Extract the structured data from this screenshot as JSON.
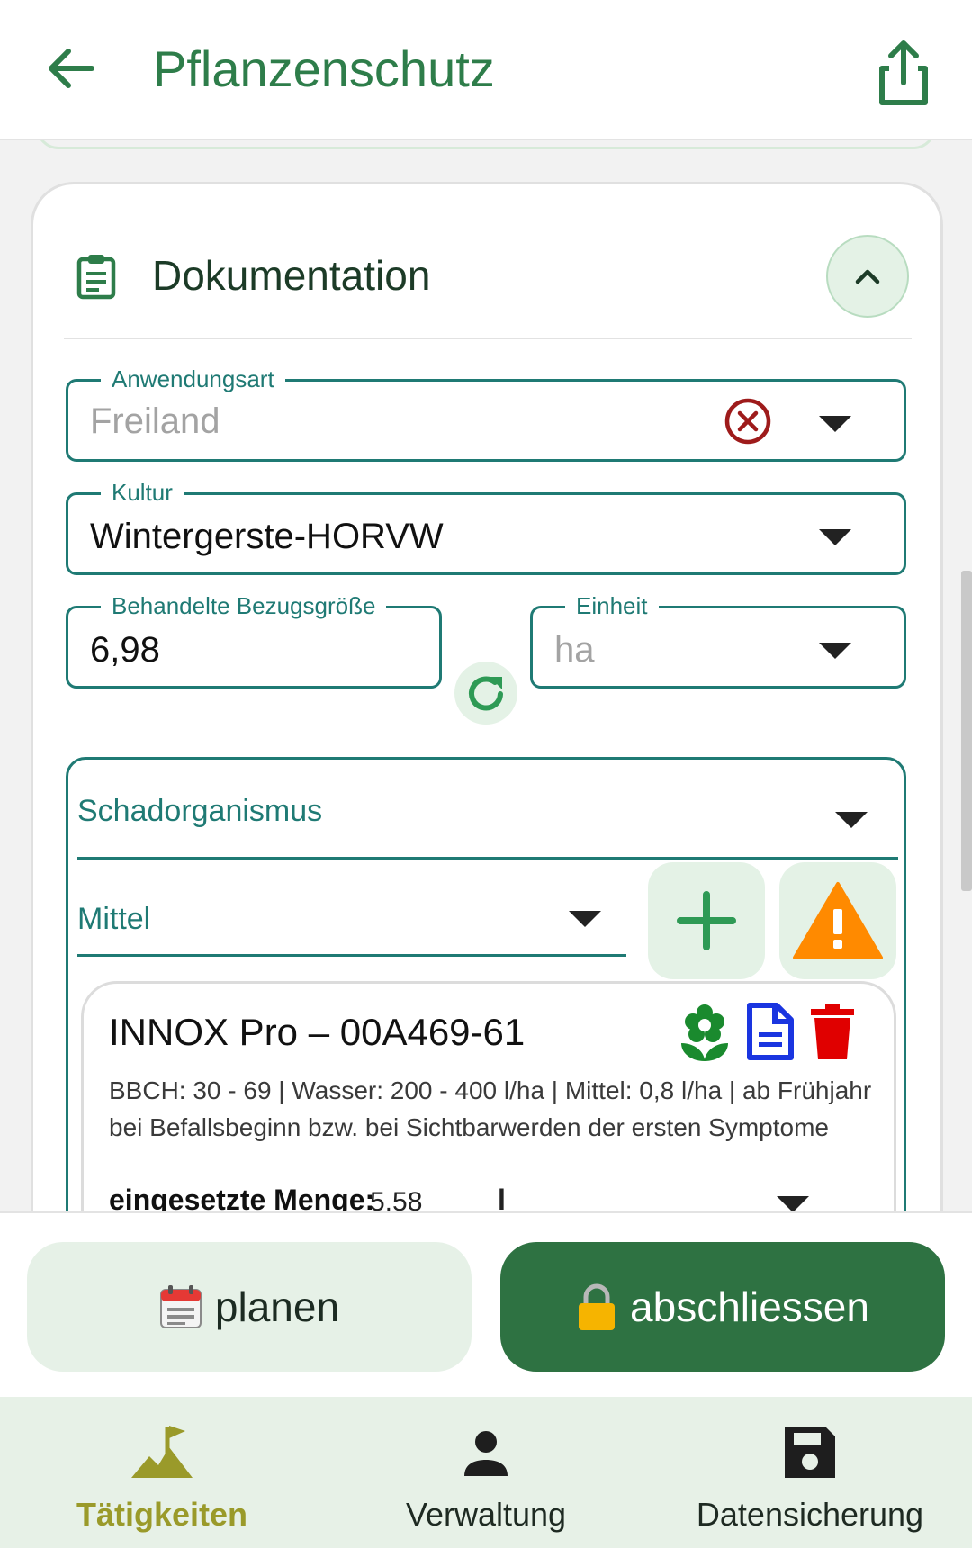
{
  "header": {
    "title": "Pflanzenschutz",
    "back_icon": "arrow-left-icon",
    "share_icon": "share-icon"
  },
  "section": {
    "title": "Dokumentation",
    "icon": "clipboard-icon",
    "collapse_icon": "chevron-up-icon"
  },
  "fields": {
    "anwendungsart": {
      "label": "Anwendungsart",
      "value": "Freiland"
    },
    "kultur": {
      "label": "Kultur",
      "value": "Wintergerste-HORVW"
    },
    "bezugsgroesse": {
      "label": "Behandelte Bezugsgröße",
      "value": "6,98"
    },
    "einheit": {
      "label": "Einheit",
      "value": "ha"
    }
  },
  "schadorganismus": {
    "label": "Schadorganismus"
  },
  "mittel": {
    "label": "Mittel",
    "add_icon": "plus-icon",
    "warning_icon": "warning-icon"
  },
  "product": {
    "name": "INNOX Pro – 00A469-61",
    "description": "BBCH: 30 - 69 | Wasser: 200 - 400 l/ha | Mittel: 0,8 l/ha | ab Frühjahr bei Befallsbeginn bzw. bei Sichtbarwerden der ersten Symptome",
    "quantity_label": "eingesetzte Menge:",
    "quantity_value": "5,58",
    "quantity_unit": "l",
    "icons": [
      "flower-icon",
      "document-icon",
      "trash-icon"
    ]
  },
  "actions": {
    "plan": {
      "label": "planen",
      "emoji": "📅"
    },
    "close": {
      "label": "abschliessen",
      "emoji": "🔒"
    }
  },
  "nav": [
    {
      "label": "Tätigkeiten",
      "icon": "terrain-flag-icon",
      "active": true
    },
    {
      "label": "Verwaltung",
      "icon": "person-icon",
      "active": false
    },
    {
      "label": "Datensicherung",
      "icon": "save-icon",
      "active": false
    }
  ],
  "colors": {
    "primary": "#2e7d4a",
    "teal": "#1f7a74",
    "nav_bg": "#e7f1e7",
    "active_nav": "#9a9a2a",
    "close_btn": "#2e7242"
  }
}
